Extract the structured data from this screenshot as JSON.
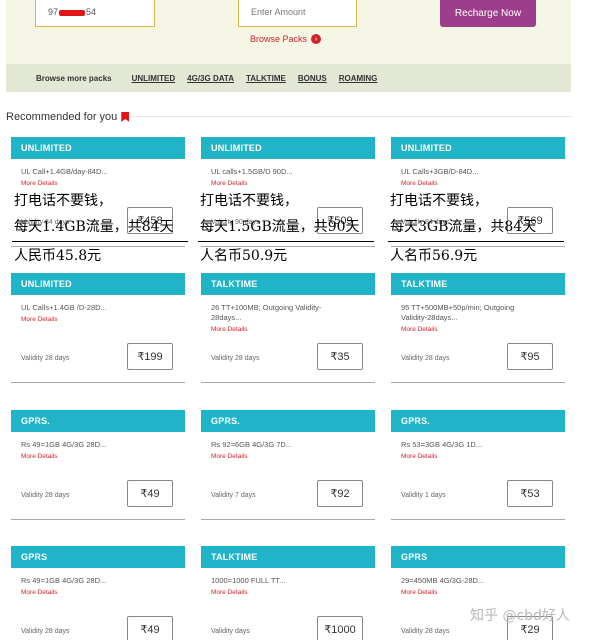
{
  "recharge": {
    "mobile_prefix": "97",
    "mobile_suffix": "54",
    "amount_placeholder": "Enter Amount",
    "recharge_button": "Recharge Now",
    "browse_packs": "Browse Packs"
  },
  "browse_more": {
    "label": "Browse more packs",
    "links": [
      "UNLIMITED",
      "4G/3G DATA",
      "TALKTIME",
      "BONUS",
      "ROAMING"
    ]
  },
  "recommended": {
    "title": "Recommended for you"
  },
  "cards": [
    {
      "category": "UNLIMITED",
      "desc": "UL Call+1.4GB/day-84D...",
      "more": "More Details",
      "validity": "Validity 84 days",
      "price": "₹458"
    },
    {
      "category": "UNLIMITED",
      "desc": "UL calls+1.5GB/D 90D...",
      "more": "More Details",
      "validity": "Validity 90 days",
      "price": "₹509"
    },
    {
      "category": "UNLIMITED",
      "desc": "UL Calls+3GB/D-84D...",
      "more": "More Details",
      "validity": "Validity 84 days",
      "price": "₹569"
    },
    {
      "category": "UNLIMITED",
      "desc": "UL Calls+1.4GB /D-28D...",
      "more": "More Details",
      "validity": "Validity 28 days",
      "price": "₹199"
    },
    {
      "category": "TALKTIME",
      "desc": "26 TT+100MB; Outgoing Validity-28days...",
      "more": "More Details",
      "validity": "Validity 28 days",
      "price": "₹35"
    },
    {
      "category": "TALKTIME",
      "desc": "95 TT+500MB+50p/min; Outgoing Validity-28days...",
      "more": "More Details",
      "validity": "Validity 28 days",
      "price": "₹95"
    },
    {
      "category": "GPRS.",
      "desc": "Rs 49=1GB 4G/3G 28D...",
      "more": "More Details",
      "validity": "Validity 28 days",
      "price": "₹49"
    },
    {
      "category": "GPRS.",
      "desc": "Rs 92=6GB 4G/3G 7D...",
      "more": "More Details",
      "validity": "Validity 7 days",
      "price": "₹92"
    },
    {
      "category": "GPRS.",
      "desc": "Rs 53=3GB 4G/3G 1D...",
      "more": "More Details",
      "validity": "Validity 1 days",
      "price": "₹53"
    },
    {
      "category": "GPRS",
      "desc": "Rs 49=1GB 4G/3G 28D...",
      "more": "More Details",
      "validity": "Validity 28 days",
      "price": "₹49"
    },
    {
      "category": "TALKTIME",
      "desc": "1000=1000 FULL TT...",
      "more": "More Details",
      "validity": "Validity days",
      "price": "₹1000"
    },
    {
      "category": "GPRS",
      "desc": "29=450MB 4G/3G-28D...",
      "more": "More Details",
      "validity": "Validity 28 days",
      "price": "₹29"
    }
  ],
  "annotations": [
    {
      "line1": "打电话不要钱，",
      "line2": "每天1.4GB流量，共84天",
      "line3": "人民币45.8元"
    },
    {
      "line1": "打电话不要钱，",
      "line2": "每天1.5GB流量，共90天",
      "line3": "人名币50.9元"
    },
    {
      "line1": "打电话不要钱，",
      "line2": "每天3GB流量，共84天",
      "line3": "人名币56.9元"
    }
  ],
  "watermark": "知乎 @cbd好人"
}
